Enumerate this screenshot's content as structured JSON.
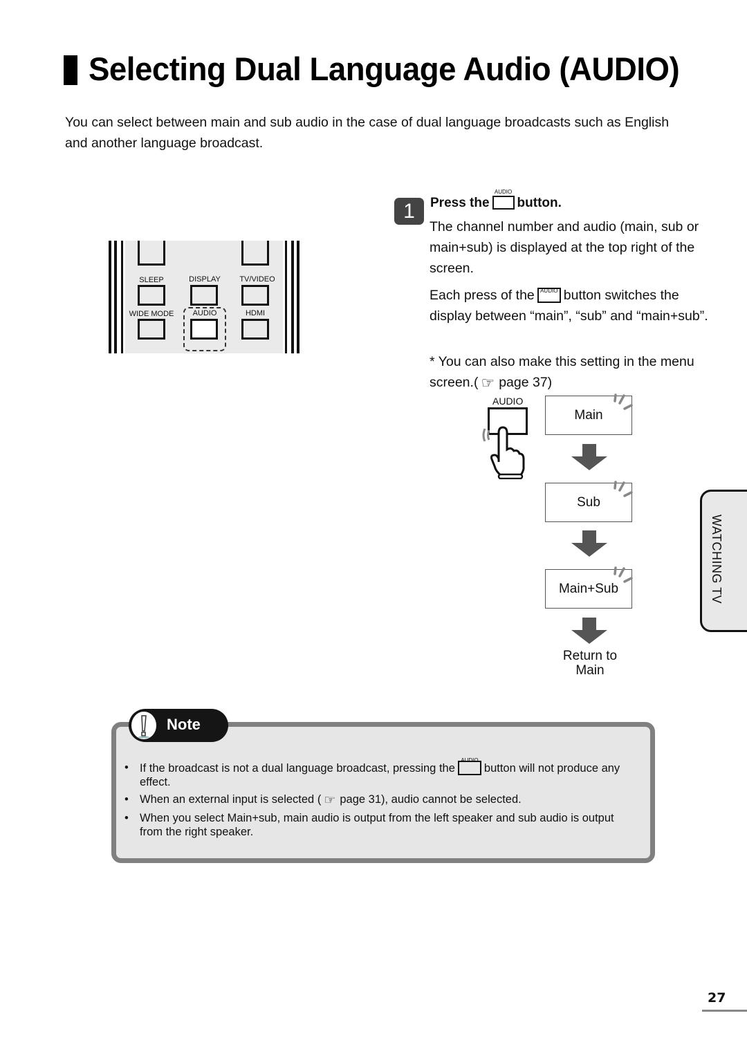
{
  "title": "Selecting Dual Language Audio (AUDIO)",
  "intro": "You can select between main and sub audio in the case of dual language broadcasts such as English and another language broadcast.",
  "remote": {
    "labels": {
      "sleep": "SLEEP",
      "display": "DISPLAY",
      "tv_video": "TV/VIDEO",
      "wide_mode": "WIDE MODE",
      "audio": "AUDIO",
      "hdmi": "HDMI"
    },
    "highlighted_button": "AUDIO"
  },
  "step": {
    "number": "1",
    "head_before": "Press the",
    "head_after": "button.",
    "button_caption": "AUDIO",
    "para1": "The channel number and audio (main, sub or main+sub) is displayed at the top right of the screen.",
    "para2_before": "Each press of the",
    "para2_after": "button switches the display between “main”, “sub” and “main+sub”.",
    "para3_before": "* You can also make this setting in the menu screen.(",
    "para3_after": "page 37)",
    "pointer_icon": "hand-pointer-icon"
  },
  "flow": {
    "button_caption": "AUDIO",
    "states": [
      "Main",
      "Sub",
      "Main+Sub"
    ],
    "return_line1": "Return to",
    "return_line2": "Main"
  },
  "side_tab": "WATCHING TV",
  "note": {
    "label": "Note",
    "bullet": "•",
    "items": {
      "item1_before": "If the broadcast is not a dual language broadcast, pressing the",
      "item1_after": "button will not produce any effect.",
      "item1_caption": "AUDIO",
      "item2_before": "When an external input is selected (",
      "item2_after": "page 31), audio cannot be selected.",
      "item3": "When you select Main+sub, main audio is output from the left speaker and sub audio is output from the right speaker."
    }
  },
  "page_number": "27",
  "colors": {
    "step_badge": "#444444",
    "note_border": "#808080",
    "note_bg": "#e6e6e6",
    "flow_arrow": "#555555",
    "side_tab_bg": "#e8e8e8"
  }
}
